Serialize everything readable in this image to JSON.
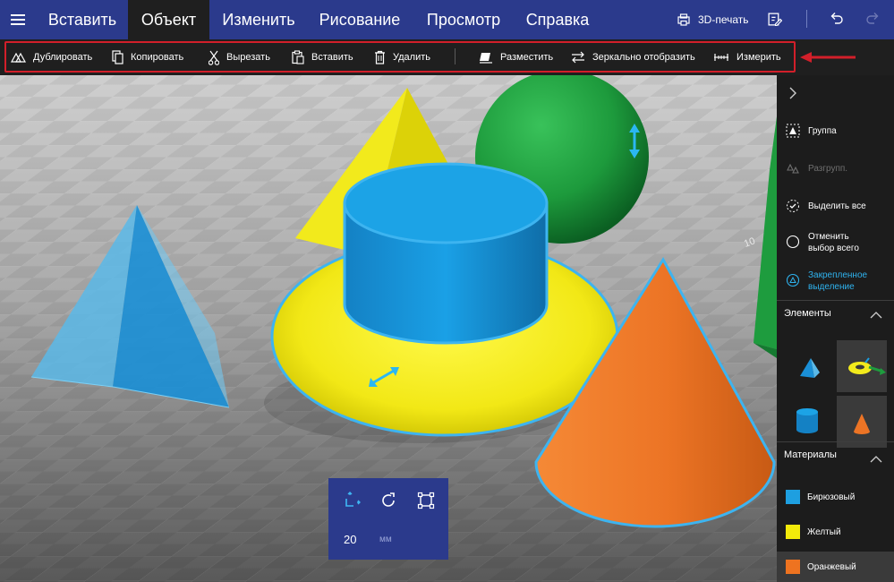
{
  "menubar": {
    "tabs": [
      {
        "label": "Вставить",
        "active": false
      },
      {
        "label": "Объект",
        "active": true
      },
      {
        "label": "Изменить",
        "active": false
      },
      {
        "label": "Рисование",
        "active": false
      },
      {
        "label": "Просмотр",
        "active": false
      },
      {
        "label": "Справка",
        "active": false
      }
    ],
    "print3d_label": "3D-печать",
    "icons": [
      "menu-icon",
      "print-3d-icon",
      "share-icon",
      "undo-icon",
      "redo-icon"
    ]
  },
  "ribbon": {
    "items": [
      {
        "label": "Дублировать",
        "icon": "duplicate-icon"
      },
      {
        "label": "Копировать",
        "icon": "copy-icon"
      },
      {
        "label": "Вырезать",
        "icon": "cut-icon"
      },
      {
        "label": "Вставить",
        "icon": "paste-icon"
      },
      {
        "label": "Удалить",
        "icon": "delete-icon"
      },
      {
        "label": "Разместить",
        "icon": "place-icon"
      },
      {
        "label": "Зеркально отобразить",
        "icon": "mirror-icon"
      },
      {
        "label": "Измерить",
        "icon": "measure-icon"
      }
    ],
    "highlight_color": "#d21f2a"
  },
  "sidepanel": {
    "actions": [
      {
        "label": "Группа",
        "icon": "group-icon",
        "enabled": true
      },
      {
        "label": "Разгрупп.",
        "icon": "ungroup-icon",
        "enabled": false
      },
      {
        "label": "Выделить все",
        "icon": "select-all-icon",
        "enabled": true
      },
      {
        "label": "Отменить выбор всего",
        "icon": "deselect-all-icon",
        "enabled": true
      },
      {
        "label": "Закрепленное выделение",
        "icon": "pin-selection-icon",
        "enabled": true
      }
    ],
    "elements_header": "Элементы",
    "elements": [
      "pyramid",
      "torus",
      "cylinder",
      "cone"
    ],
    "materials_header": "Материалы",
    "materials": [
      {
        "label": "Бирюзовый",
        "color": "#1e9fe0"
      },
      {
        "label": "Желтый",
        "color": "#f2ea0a"
      },
      {
        "label": "Оранжевый",
        "color": "#ee7320"
      }
    ]
  },
  "gizmo": {
    "value": "20",
    "unit": "мм",
    "icons": [
      "move-icon",
      "rotate-icon",
      "scale-icon"
    ]
  },
  "viewport": {
    "grid_label": "10",
    "colors": {
      "blue": "#1a9ee0",
      "yellow": "#f0eb1a",
      "green": "#1e9c3e",
      "orange": "#ed7423",
      "selection": "#3db4f0"
    }
  }
}
